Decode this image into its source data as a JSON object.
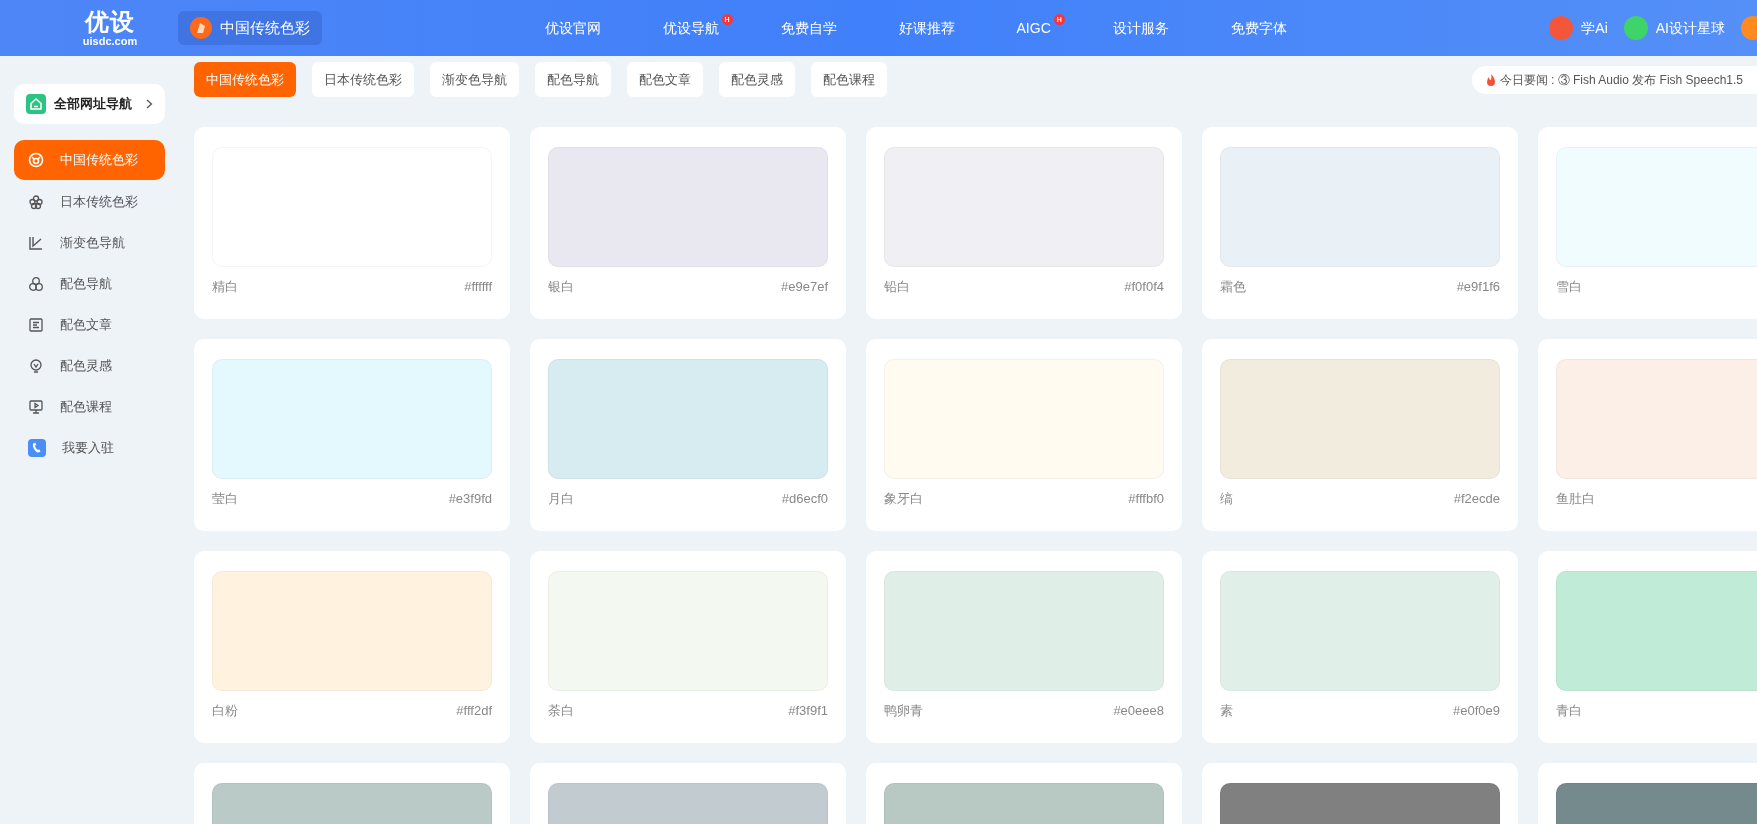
{
  "header": {
    "logo": {
      "title": "优设",
      "domain": "uisdc.com"
    },
    "current_site": "中国传统色彩",
    "nav": [
      {
        "label": "优设官网"
      },
      {
        "label": "优设导航",
        "badge": "H"
      },
      {
        "label": "免费自学"
      },
      {
        "label": "好课推荐"
      },
      {
        "label": "AIGC",
        "badge": "H"
      },
      {
        "label": "设计服务"
      },
      {
        "label": "免费字体"
      }
    ],
    "right_links": [
      {
        "label": "学Ai",
        "color": "#f4563a"
      },
      {
        "label": "AI设计星球",
        "color": "#3ed46a"
      },
      {
        "color": "#ff8a1f"
      }
    ]
  },
  "sub_tabs": [
    {
      "label": "中国传统色彩",
      "selected": true
    },
    {
      "label": "日本传统色彩",
      "selected": false
    },
    {
      "label": "渐变色导航",
      "selected": false
    },
    {
      "label": "配色导航",
      "selected": false
    },
    {
      "label": "配色文章",
      "selected": false
    },
    {
      "label": "配色灵感",
      "selected": false
    },
    {
      "label": "配色课程",
      "selected": false
    }
  ],
  "news": "今日要闻 : ③ Fish Audio 发布 Fish Speech1.5",
  "sidebar": {
    "all_sites": "全部网址导航",
    "items": [
      {
        "label": "中国传统色彩",
        "selected": true
      },
      {
        "label": "日本传统色彩",
        "selected": false
      },
      {
        "label": "渐变色导航",
        "selected": false
      },
      {
        "label": "配色导航",
        "selected": false
      },
      {
        "label": "配色文章",
        "selected": false
      },
      {
        "label": "配色灵感",
        "selected": false
      },
      {
        "label": "配色课程",
        "selected": false
      },
      {
        "label": "我要入驻",
        "selected": false
      }
    ]
  },
  "colors": [
    {
      "name": "精白",
      "hex": "#ffffff",
      "color": "#ffffff"
    },
    {
      "name": "银白",
      "hex": "#e9e7ef",
      "color": "#e9e7ef"
    },
    {
      "name": "铅白",
      "hex": "#f0f0f4",
      "color": "#f0f0f4"
    },
    {
      "name": "霜色",
      "hex": "#e9f1f6",
      "color": "#e9f1f6"
    },
    {
      "name": "雪白",
      "color": "#f0fcff"
    },
    {
      "name": "莹白",
      "hex": "#e3f9fd",
      "color": "#e3f9fd"
    },
    {
      "name": "月白",
      "hex": "#d6ecf0",
      "color": "#d6ecf0"
    },
    {
      "name": "象牙白",
      "hex": "#fffbf0",
      "color": "#fffbf0"
    },
    {
      "name": "缟",
      "hex": "#f2ecde",
      "color": "#f2ecde"
    },
    {
      "name": "鱼肚白",
      "color": "#fcefe8"
    },
    {
      "name": "白粉",
      "hex": "#fff2df",
      "color": "#fff2df"
    },
    {
      "name": "荼白",
      "hex": "#f3f9f1",
      "color": "#f3f9f1"
    },
    {
      "name": "鸭卵青",
      "hex": "#e0eee8",
      "color": "#e0eee8"
    },
    {
      "name": "素",
      "hex": "#e0f0e9",
      "color": "#e0f0e9"
    },
    {
      "name": "青白",
      "color": "#c0ebd7"
    },
    {
      "color": "#bacac6"
    },
    {
      "color": "#c2ccd0"
    },
    {
      "color": "#b8c9c4"
    },
    {
      "color": "#808080"
    },
    {
      "color": "#758a8c"
    }
  ]
}
